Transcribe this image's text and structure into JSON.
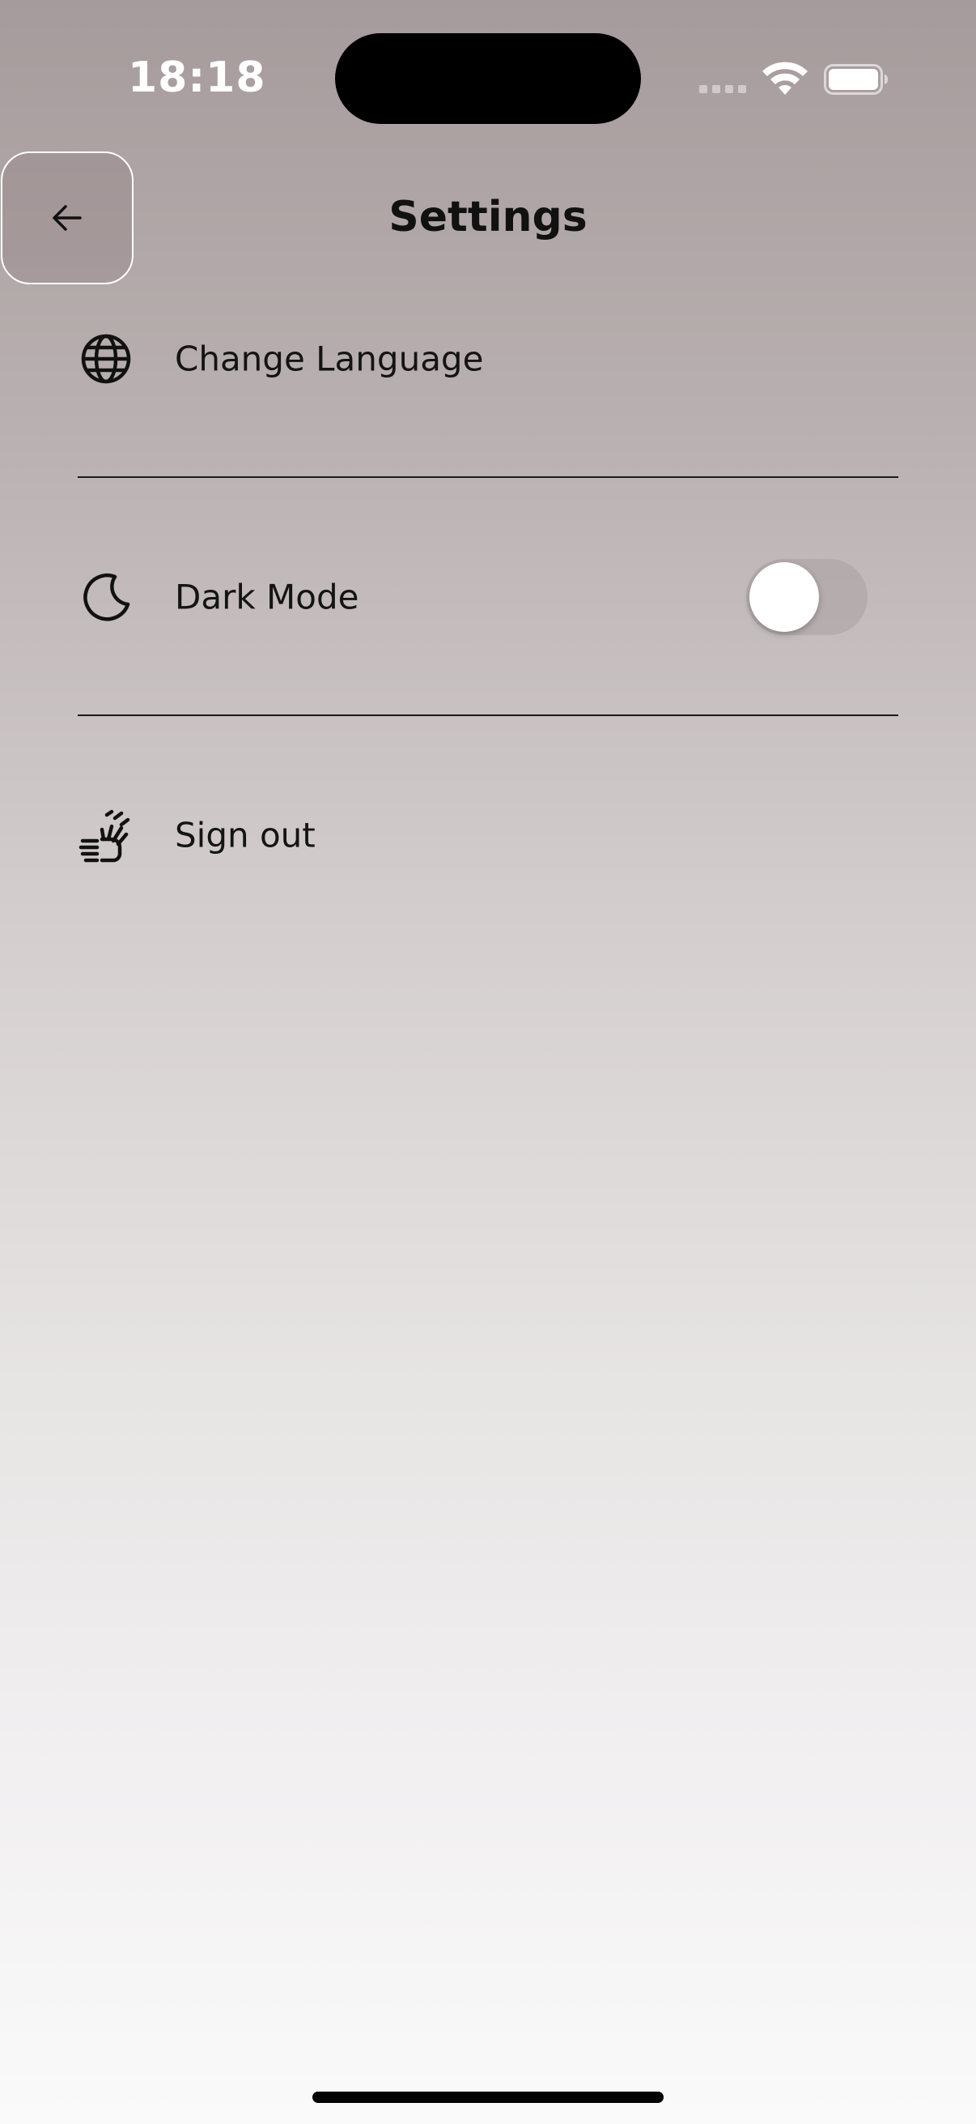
{
  "status_bar": {
    "time": "18:18",
    "signal_icon": "cellular-signal-icon",
    "wifi_icon": "wifi-icon",
    "battery_icon": "battery-icon"
  },
  "header": {
    "title": "Settings",
    "back_icon": "arrow-left-icon"
  },
  "settings": {
    "items": [
      {
        "label": "Change Language",
        "icon": "globe-icon"
      },
      {
        "label": "Dark Mode",
        "icon": "moon-icon",
        "toggle_on": false
      },
      {
        "label": "Sign out",
        "icon": "waving-hand-icon"
      }
    ]
  },
  "colors": {
    "text": "#141414",
    "divider": "#1a1a1a",
    "background_top": "#a69b9c",
    "background_bottom": "#fafafa"
  }
}
